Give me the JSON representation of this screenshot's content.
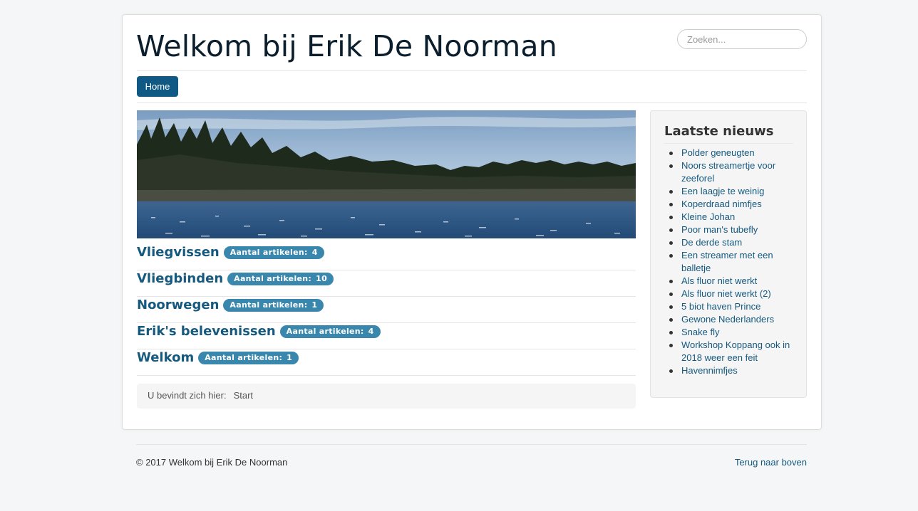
{
  "header": {
    "site_title": "Welkom bij Erik De Noorman",
    "search_placeholder": "Zoeken..."
  },
  "nav": {
    "items": [
      {
        "label": "Home",
        "active": true
      }
    ]
  },
  "banner": {
    "image": "lake-landscape"
  },
  "categories": [
    {
      "name": "Vliegvissen",
      "badge_label": "Aantal artikelen:",
      "count": "4"
    },
    {
      "name": "Vliegbinden",
      "badge_label": "Aantal artikelen:",
      "count": "10"
    },
    {
      "name": "Noorwegen",
      "badge_label": "Aantal artikelen:",
      "count": "1"
    },
    {
      "name": "Erik's belevenissen",
      "badge_label": "Aantal artikelen:",
      "count": "4"
    },
    {
      "name": "Welkom",
      "badge_label": "Aantal artikelen:",
      "count": "1"
    }
  ],
  "breadcrumb": {
    "prefix": "U bevindt zich hier:",
    "current": "Start"
  },
  "sidebar": {
    "title": "Laatste nieuws",
    "items": [
      "Polder geneugten",
      "Noors streamertje voor zeeforel",
      "Een laagje te weinig",
      "Koperdraad nimfjes",
      "Kleine Johan",
      "Poor man's tubefly",
      "De derde stam",
      "Een streamer met een balletje",
      "Als fluor niet werkt",
      "Als fluor niet werkt (2)",
      "5 biot haven Prince",
      "Gewone Nederlanders",
      "Snake fly",
      "Workshop Koppang ook in 2018 weer een feit",
      "Havennimfjes"
    ]
  },
  "footer": {
    "copyright": "© 2017 Welkom bij Erik De Noorman",
    "back_to_top": "Terug naar boven"
  },
  "colors": {
    "accent": "#105985",
    "link": "#15597f",
    "badge": "#3a87ad",
    "page_bg": "#f4f6f7"
  }
}
